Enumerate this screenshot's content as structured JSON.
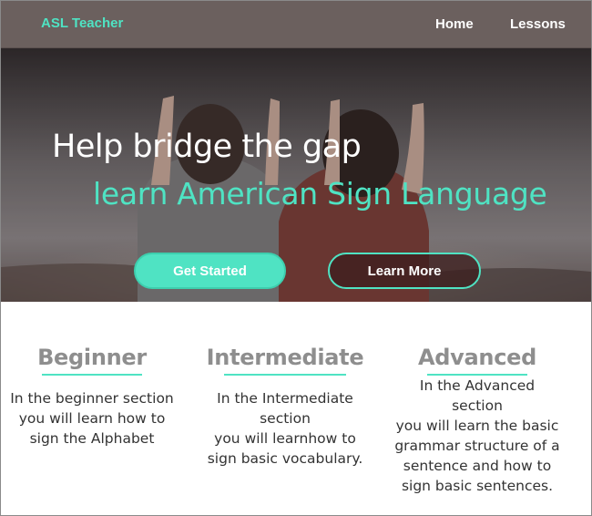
{
  "navbar": {
    "brand": "ASL Teacher",
    "links": [
      {
        "label": "Home"
      },
      {
        "label": "Lessons"
      }
    ]
  },
  "hero": {
    "headline": "Help bridge the gap",
    "subheadline": "learn American Sign Language",
    "buttons": {
      "primary": "Get Started",
      "secondary": "Learn More"
    }
  },
  "levels": [
    {
      "title": "Beginner",
      "lines": [
        "In the beginner section",
        "you will learn how to",
        "sign the Alphabet"
      ]
    },
    {
      "title": "Intermediate",
      "lines": [
        "In the Intermediate",
        "section",
        "you will learnhow to",
        "sign basic vocabulary."
      ]
    },
    {
      "title": "Advanced",
      "lines": [
        "In the Advanced",
        "section",
        "you will learn the basic",
        "grammar structure of a",
        "sentence and how to",
        "sign basic sentences."
      ]
    }
  ],
  "colors": {
    "accent": "#4fe3c3",
    "navbar": "#6b605e",
    "heading_gray": "#8e8e8e"
  }
}
